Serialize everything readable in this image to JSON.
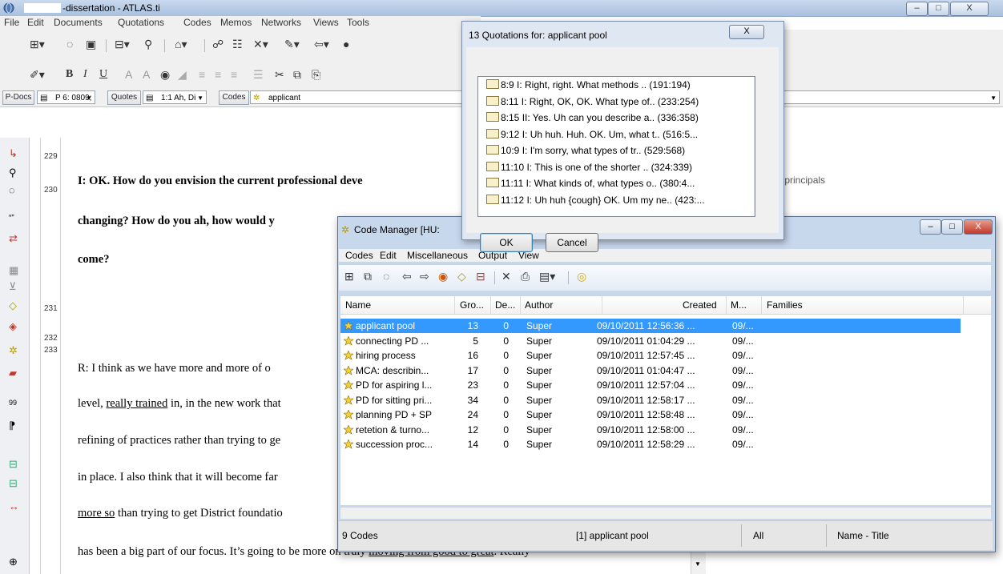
{
  "window": {
    "title": "-dissertation - ATLAS.ti",
    "controls": {
      "minimize": "–",
      "maximize": "□",
      "close": "X"
    }
  },
  "menu": [
    "File",
    "Edit",
    "Documents",
    "Quotations",
    "Codes",
    "Memos",
    "Networks",
    "Views",
    "Tools"
  ],
  "selector_bar": {
    "pdocs_label": "P-Docs",
    "pdoc_value": "P 6: 0809;",
    "quotes_label": "Quotes",
    "quote_value": "1:1 Ah, Di",
    "codes_label": "Codes",
    "code_value": "applicant"
  },
  "line_numbers": [
    "229",
    "230",
    "231",
    "232",
    "233"
  ],
  "document": {
    "line1": "I:  OK.  How do you envision the current professional deve",
    "line2": "changing?  How do you ah, how would y",
    "line3": "come?",
    "line4": "R:  I think as we have more and more of o",
    "line5a": "level, ",
    "line5b": "really trained",
    "line5c": " in, in the new work that",
    "line6": "refining of practices rather than trying to ge",
    "line7": "in place.  I also think that it will become far",
    "line8a": "more so",
    "line8b": " than trying to get District foundatio",
    "line9a": "has been a big part of our focus.  It’s going to be more on truly ",
    "line9b": "moving from good to great",
    "line9c": ".  Really",
    "margin_note": "ing principals"
  },
  "quotations_dialog": {
    "title": "13 Quotations for: applicant pool",
    "close": "X",
    "items": [
      "8:9 I: Right, right. What methods .. (191:194)",
      "8:11 I: Right, OK, OK. What type of.. (233:254)",
      "8:15 II: Yes. Uh can you describe a.. (336:358)",
      "9:12 I: Uh huh. Huh. OK. Um, what t.. (516:5...",
      "10:9 I: I'm sorry, what types of tr.. (529:568)",
      "11:10 I: This is one of the shorter .. (324:339)",
      "11:11 I: What kinds of, what types o.. (380:4...",
      "11:12 I: Uh huh {cough} OK. Um my ne.. (423:..."
    ],
    "ok_label": "OK",
    "cancel_label": "Cancel"
  },
  "code_manager": {
    "title": "Code Manager [HU:",
    "menu": [
      "Codes",
      "Edit",
      "Miscellaneous",
      "Output",
      "View"
    ],
    "columns": [
      "Name",
      "Gro...",
      "De...",
      "Author",
      "Created",
      "M...",
      "Families"
    ],
    "rows": [
      {
        "name": "applicant pool",
        "gro": "13",
        "de": "0",
        "author": "Super",
        "created": "09/10/2011 12:56:36 ...",
        "m": "09/..."
      },
      {
        "name": "connecting PD ...",
        "gro": "5",
        "de": "0",
        "author": "Super",
        "created": "09/10/2011 01:04:29 ...",
        "m": "09/..."
      },
      {
        "name": "hiring process",
        "gro": "16",
        "de": "0",
        "author": "Super",
        "created": "09/10/2011 12:57:45 ...",
        "m": "09/..."
      },
      {
        "name": "MCA: describin...",
        "gro": "17",
        "de": "0",
        "author": "Super",
        "created": "09/10/2011 01:04:47 ...",
        "m": "09/..."
      },
      {
        "name": "PD for aspiring l...",
        "gro": "23",
        "de": "0",
        "author": "Super",
        "created": "09/10/2011 12:57:04 ...",
        "m": "09/..."
      },
      {
        "name": "PD for sitting pri...",
        "gro": "34",
        "de": "0",
        "author": "Super",
        "created": "09/10/2011 12:58:17 ...",
        "m": "09/..."
      },
      {
        "name": "planning PD + SP",
        "gro": "24",
        "de": "0",
        "author": "Super",
        "created": "09/10/2011 12:58:48 ...",
        "m": "09/..."
      },
      {
        "name": "retetion & turno...",
        "gro": "12",
        "de": "0",
        "author": "Super",
        "created": "09/10/2011 12:58:00 ...",
        "m": "09/..."
      },
      {
        "name": "succession proc...",
        "gro": "14",
        "de": "0",
        "author": "Super",
        "created": "09/10/2011 12:58:29 ...",
        "m": "09/..."
      }
    ],
    "status": {
      "count": "9 Codes",
      "selected": "[1] applicant pool",
      "filter": "All",
      "sort": "Name - Title"
    },
    "selection_color": "#3399ff"
  }
}
